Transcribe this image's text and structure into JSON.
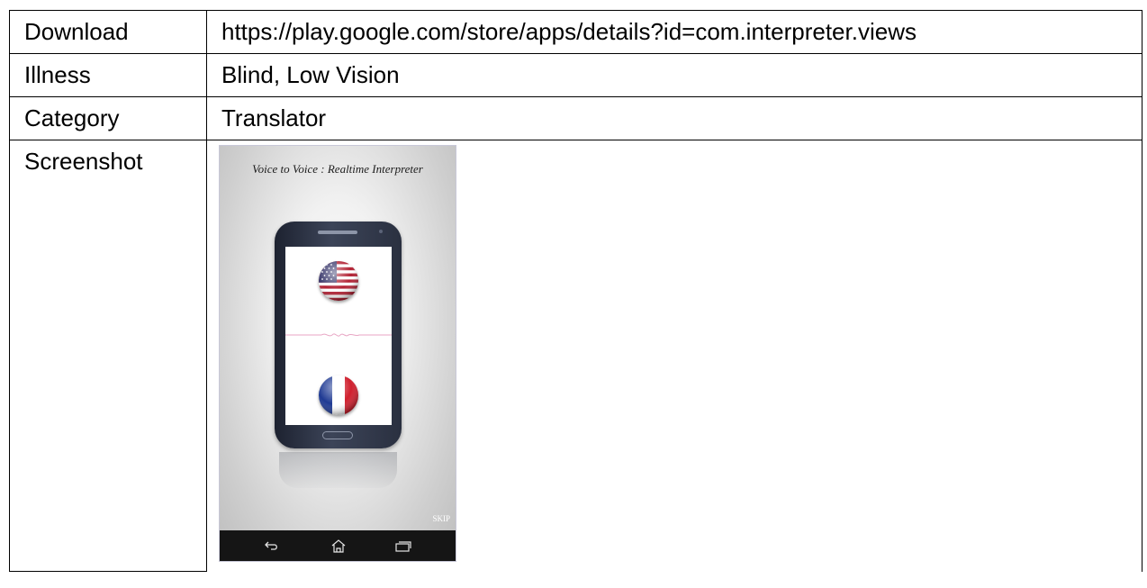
{
  "table": {
    "rows": [
      {
        "label": "Download",
        "value": "https://play.google.com/store/apps/details?id=com.interpreter.views"
      },
      {
        "label": "Illness",
        "value": "Blind, Low Vision"
      },
      {
        "label": "Category",
        "value": "Translator"
      },
      {
        "label": "Screenshot"
      }
    ]
  },
  "app_screenshot": {
    "title": "Voice to Voice : Realtime Interpreter",
    "skip_label": "SKIP",
    "flags": [
      "us-flag-icon",
      "france-flag-icon"
    ],
    "nav_icons": [
      "back-icon",
      "home-icon",
      "recent-apps-icon"
    ],
    "colors": {
      "phone_body": "#2a3040",
      "navbar": "#151515",
      "wave": "#e8a6c4"
    }
  }
}
